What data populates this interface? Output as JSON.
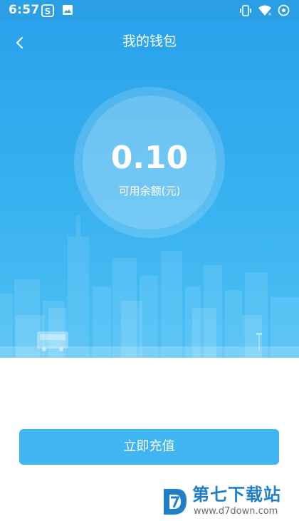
{
  "status_bar": {
    "time": "6:57",
    "left_icons": [
      "sogou-icon",
      "gallery-icon"
    ],
    "right_icons": [
      "vibrate-icon",
      "wifi-icon",
      "data-saver-icon"
    ]
  },
  "header": {
    "title": "我的钱包",
    "back_icon": "chevron-left-icon"
  },
  "wallet": {
    "balance": "0.10",
    "balance_label": "可用余额(元)"
  },
  "actions": {
    "recharge_label": "立即充值"
  },
  "watermark": {
    "text": "第七下载站",
    "url": "www.d7down.com"
  },
  "colors": {
    "primary": "#2aa2ec",
    "button": "#3fb5f2",
    "text_on_primary": "#ffffff"
  }
}
